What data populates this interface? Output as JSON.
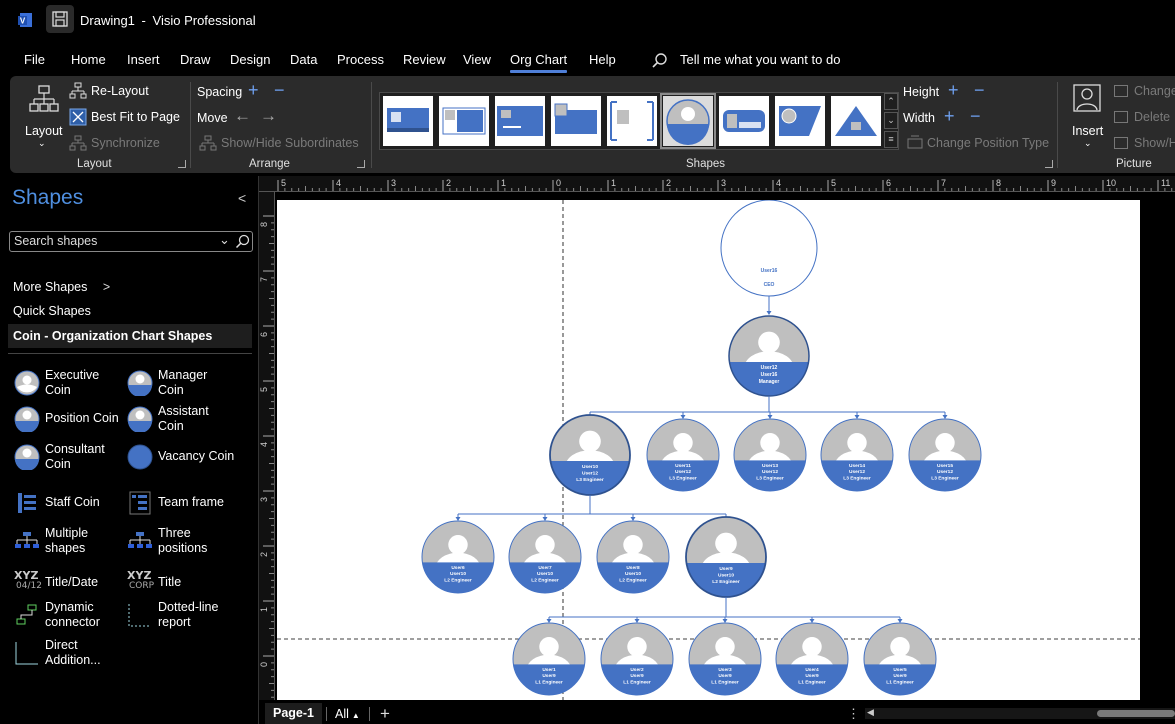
{
  "titlebar": {
    "doc_name": "Drawing1",
    "separator": "-",
    "app_name": "Visio Professional"
  },
  "menu": {
    "items": [
      "File",
      "Home",
      "Insert",
      "Draw",
      "Design",
      "Data",
      "Process",
      "Review",
      "View",
      "Org Chart",
      "Help"
    ],
    "active": "Org Chart",
    "tell_me": "Tell me what you want to do"
  },
  "ribbon": {
    "layout_group": {
      "layout_label": "Layout",
      "relayout": "Re-Layout",
      "best_fit": "Best Fit to Page",
      "synchronize": "Synchronize",
      "group_label": "Layout"
    },
    "arrange_group": {
      "spacing": "Spacing",
      "move": "Move",
      "show_hide": "Show/Hide Subordinates",
      "group_label": "Arrange"
    },
    "shapes_group": {
      "height": "Height",
      "width": "Width",
      "change_position_type": "Change Position Type",
      "group_label": "Shapes"
    },
    "picture_group": {
      "insert": "Insert",
      "change": "Change",
      "delete": "Delete",
      "show_hide": "Show/H",
      "group_label": "Picture"
    }
  },
  "shapes_pane": {
    "title": "Shapes",
    "search_placeholder": "Search shapes",
    "more_shapes": "More Shapes",
    "quick_shapes": "Quick Shapes",
    "stencil": "Coin - Organization Chart Shapes",
    "items": [
      {
        "label": "Executive\nCoin",
        "icon": "executive-coin-icon"
      },
      {
        "label": "Manager\nCoin",
        "icon": "manager-coin-icon"
      },
      {
        "label": "Position Coin",
        "icon": "position-coin-icon"
      },
      {
        "label": "Assistant\nCoin",
        "icon": "assistant-coin-icon"
      },
      {
        "label": "Consultant\nCoin",
        "icon": "consultant-coin-icon"
      },
      {
        "label": "Vacancy Coin",
        "icon": "vacancy-coin-icon"
      },
      {
        "label": "Staff Coin",
        "icon": "staff-coin-icon"
      },
      {
        "label": "Team frame",
        "icon": "team-frame-icon"
      },
      {
        "label": "Multiple\nshapes",
        "icon": "multiple-shapes-icon"
      },
      {
        "label": "Three\npositions",
        "icon": "three-positions-icon"
      },
      {
        "label": "Title/Date",
        "icon": "title-date-icon"
      },
      {
        "label": "Title",
        "icon": "title-icon"
      },
      {
        "label": "Dynamic\nconnector",
        "icon": "dynamic-connector-icon"
      },
      {
        "label": "Dotted-line\nreport",
        "icon": "dotted-line-report-icon"
      },
      {
        "label": "Direct\nAddition...",
        "icon": "direct-addition-icon"
      }
    ],
    "icon_glyphs": {
      "title_date_top": "XYZ",
      "title_date_bottom": "04/12",
      "title_top": "XYZ",
      "title_bottom": "CORP"
    }
  },
  "rulers": {
    "horizontal": [
      "5",
      "4",
      "3",
      "2",
      "1",
      "0",
      "1",
      "2",
      "3",
      "4",
      "5",
      "6",
      "7",
      "8",
      "9",
      "10",
      "11"
    ],
    "vertical": [
      "8",
      "7",
      "6",
      "5",
      "4",
      "3",
      "2",
      "1",
      "0"
    ]
  },
  "org_chart": {
    "ceo": {
      "lines": [
        "User16",
        "",
        "CEO"
      ]
    },
    "manager": {
      "lines": [
        "User12",
        "User16",
        "Manager"
      ]
    },
    "level3": [
      {
        "lines": [
          "User10",
          "User12",
          "L3 Engineer"
        ]
      },
      {
        "lines": [
          "User11",
          "User12",
          "L3 Engineer"
        ]
      },
      {
        "lines": [
          "User13",
          "User12",
          "L3 Engineer"
        ]
      },
      {
        "lines": [
          "User14",
          "User12",
          "L3 Engineer"
        ]
      },
      {
        "lines": [
          "User15",
          "User12",
          "L3 Engineer"
        ]
      }
    ],
    "level2": [
      {
        "lines": [
          "User6",
          "User10",
          "L2 Engineer"
        ]
      },
      {
        "lines": [
          "User7",
          "User10",
          "L2 Engineer"
        ]
      },
      {
        "lines": [
          "User8",
          "User10",
          "L2 Engineer"
        ]
      },
      {
        "lines": [
          "User9",
          "User10",
          "L2 Engineer"
        ]
      }
    ],
    "level1": [
      {
        "lines": [
          "User1",
          "User9",
          "L1 Engineer"
        ]
      },
      {
        "lines": [
          "User2",
          "User9",
          "L1 Engineer"
        ]
      },
      {
        "lines": [
          "User3",
          "User9",
          "L1 Engineer"
        ]
      },
      {
        "lines": [
          "User4",
          "User9",
          "L1 Engineer"
        ]
      },
      {
        "lines": [
          "User5",
          "User9",
          "L1 Engineer"
        ]
      }
    ],
    "colors": {
      "coin_blue": "#4472c4",
      "coin_dark": "#2f528f",
      "avatar_gray": "#bfbfbf",
      "connector": "#4472c4"
    }
  },
  "pagebar": {
    "page": "Page-1",
    "all": "All"
  }
}
